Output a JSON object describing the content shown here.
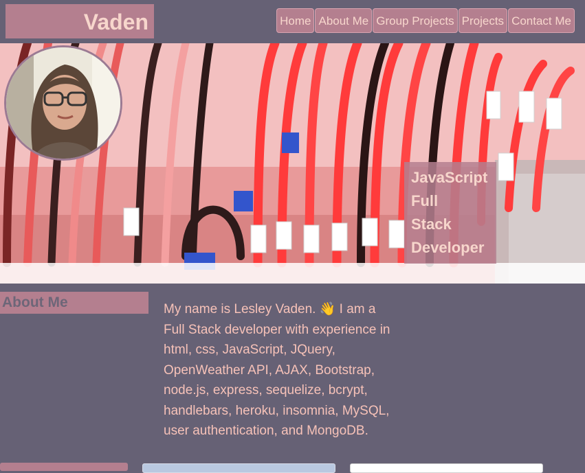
{
  "header": {
    "logo": "Vaden"
  },
  "nav": {
    "items": [
      "Home",
      "About Me",
      "Group Projects",
      "Projects",
      "Contact Me"
    ]
  },
  "hero": {
    "tagline": [
      "JavaScript",
      "Full",
      "Stack",
      "Developer"
    ]
  },
  "about": {
    "heading": "About Me",
    "lines": [
      "My name is Lesley Vaden.  👋 I am a",
      "Full Stack developer with experience in",
      "html, css, JavaScript, JQuery,",
      "OpenWeather API, AJAX, Bootstrap,",
      "node.js, express, sequelize, bcrypt,",
      "handlebars, heroku, insomnia, MySQL,",
      "user authentication, and MongoDB."
    ]
  },
  "colors": {
    "background": "#666175",
    "accent": "#b47f8f",
    "text_light": "#f7d6cc",
    "text_body": "#f7c2b8"
  }
}
